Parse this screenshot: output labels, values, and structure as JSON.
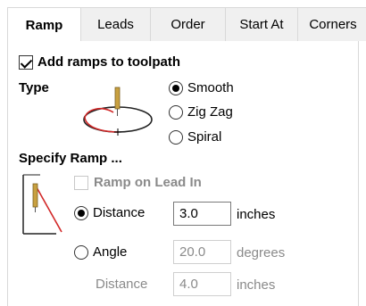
{
  "tabs": [
    {
      "label": "Ramp"
    },
    {
      "label": "Leads"
    },
    {
      "label": "Order"
    },
    {
      "label": "Start At"
    },
    {
      "label": "Corners"
    }
  ],
  "ramps": {
    "add_label": "Add ramps to toolpath",
    "add_checked": true
  },
  "type": {
    "label": "Type",
    "options": [
      {
        "label": "Smooth",
        "selected": true
      },
      {
        "label": "Zig Zag",
        "selected": false
      },
      {
        "label": "Spiral",
        "selected": false
      }
    ]
  },
  "specify": {
    "heading": "Specify Ramp ...",
    "lead_in_label": "Ramp on Lead In",
    "lead_in_checked": false,
    "distance": {
      "label": "Distance",
      "value": "3.0",
      "unit": "inches",
      "selected": true
    },
    "angle": {
      "label": "Angle",
      "value": "20.0",
      "unit": "degrees",
      "selected": false
    },
    "angle_distance": {
      "label": "Distance",
      "value": "4.0",
      "unit": "inches"
    }
  },
  "colors": {
    "accent_line": "#d22828",
    "tool": "#c8a040"
  }
}
